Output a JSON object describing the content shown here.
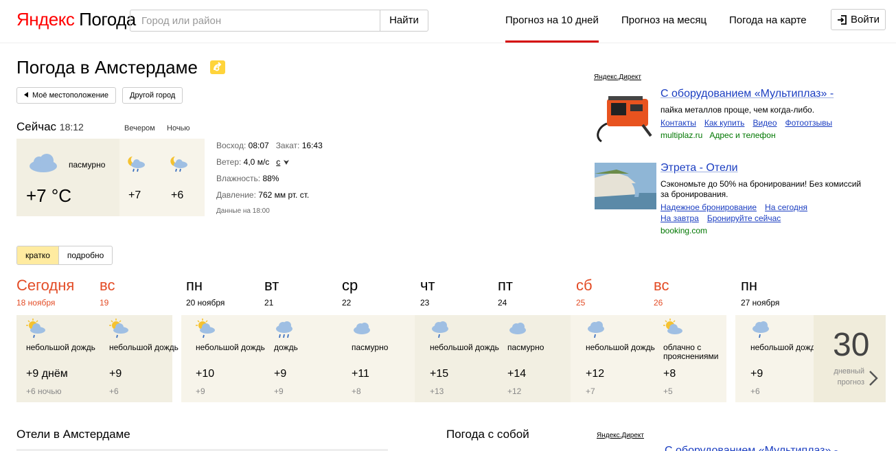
{
  "header": {
    "logo_brand": "Яндекс",
    "logo_service": "Погода",
    "search_placeholder": "Город или район",
    "search_button": "Найти",
    "tabs": [
      {
        "label": "Прогноз на 10 дней",
        "active": true
      },
      {
        "label": "Прогноз на месяц",
        "active": false
      },
      {
        "label": "Погода на карте",
        "active": false
      }
    ],
    "login": "Войти"
  },
  "title": "Погода в Амстердаме",
  "location_buttons": {
    "my_location": "Моё местоположение",
    "other_city": "Другой город"
  },
  "current": {
    "label": "Сейчас",
    "time": "18:12",
    "evening_label": "Вечером",
    "night_label": "Ночью",
    "condition": "пасмурно",
    "temp": "+7 °C",
    "evening_temp": "+7",
    "night_temp": "+6",
    "sunrise_label": "Восход:",
    "sunrise": "08:07",
    "sunset_label": "Закат:",
    "sunset": "16:43",
    "wind_label": "Ветер:",
    "wind": "4,0 м/с",
    "wind_dir": "с",
    "humidity_label": "Влажность:",
    "humidity": "88%",
    "pressure_label": "Давление:",
    "pressure": "762 мм рт. ст.",
    "data_note": "Данные на 18:00"
  },
  "ads": {
    "label": "Яндекс.Директ",
    "items": [
      {
        "title": "С оборудованием «Мультиплаз» -",
        "text": "пайка металлов проще, чем когда-либо.",
        "links": [
          "Контакты",
          "Как купить",
          "Видео",
          "Фотоотзывы"
        ],
        "url": "multiplaz.ru",
        "url_extra": "Адрес и телефон"
      },
      {
        "title": "Этрета - Отели",
        "text": "Сэкономьте до 50% на бронировании! Без комиссий за бронирования.",
        "links_row1": [
          "Надежное бронирование",
          "На сегодня"
        ],
        "links_row2": [
          "На завтра",
          "Бронируйте сейчас"
        ],
        "url": "booking.com"
      }
    ]
  },
  "view_toggle": {
    "brief": "кратко",
    "detailed": "подробно"
  },
  "forecast": [
    {
      "name": "Сегодня",
      "date": "18 ноября",
      "weekend": true,
      "icon": "sun-cloud-rain-icon",
      "cond": "небольшой дождь",
      "day": "+9 днём",
      "night": "+6 ночью"
    },
    {
      "name": "вс",
      "date": "19",
      "weekend": true,
      "icon": "sun-cloud-rain-icon",
      "cond": "небольшой дождь",
      "day": "+9",
      "night": "+6"
    },
    {
      "name": "пн",
      "date": "20 ноября",
      "weekend": false,
      "icon": "sun-cloud-rain-icon",
      "cond": "небольшой дождь",
      "day": "+10",
      "night": "+9"
    },
    {
      "name": "вт",
      "date": "21",
      "weekend": false,
      "icon": "cloud-rain-icon",
      "cond": "дождь",
      "day": "+9",
      "night": "+9"
    },
    {
      "name": "ср",
      "date": "22",
      "weekend": false,
      "icon": "cloud-icon",
      "cond": "пасмурно",
      "day": "+11",
      "night": "+8"
    },
    {
      "name": "чт",
      "date": "23",
      "weekend": false,
      "icon": "cloud-light-rain-icon",
      "cond": "небольшой дождь",
      "day": "+15",
      "night": "+13"
    },
    {
      "name": "пт",
      "date": "24",
      "weekend": false,
      "icon": "cloud-icon",
      "cond": "пасмурно",
      "day": "+14",
      "night": "+12"
    },
    {
      "name": "сб",
      "date": "25",
      "weekend": true,
      "icon": "cloud-light-rain-icon",
      "cond": "небольшой дождь",
      "day": "+12",
      "night": "+7"
    },
    {
      "name": "вс",
      "date": "26",
      "weekend": true,
      "icon": "sun-cloud-icon",
      "cond": "облачно с прояснениями",
      "day": "+8",
      "night": "+5"
    },
    {
      "name": "пн",
      "date": "27 ноября",
      "weekend": false,
      "icon": "cloud-light-rain-icon",
      "cond": "небольшой дождь",
      "day": "+9",
      "night": "+6"
    }
  ],
  "more_forecast": {
    "number": "30",
    "text": "дневный прогноз"
  },
  "bottom": {
    "hotels_title": "Отели в Амстердаме",
    "weather_with_you": "Погода с собой",
    "ad_label": "Яндекс.Директ",
    "ad_title": "С оборудованием «Мультиплаз» -"
  }
}
